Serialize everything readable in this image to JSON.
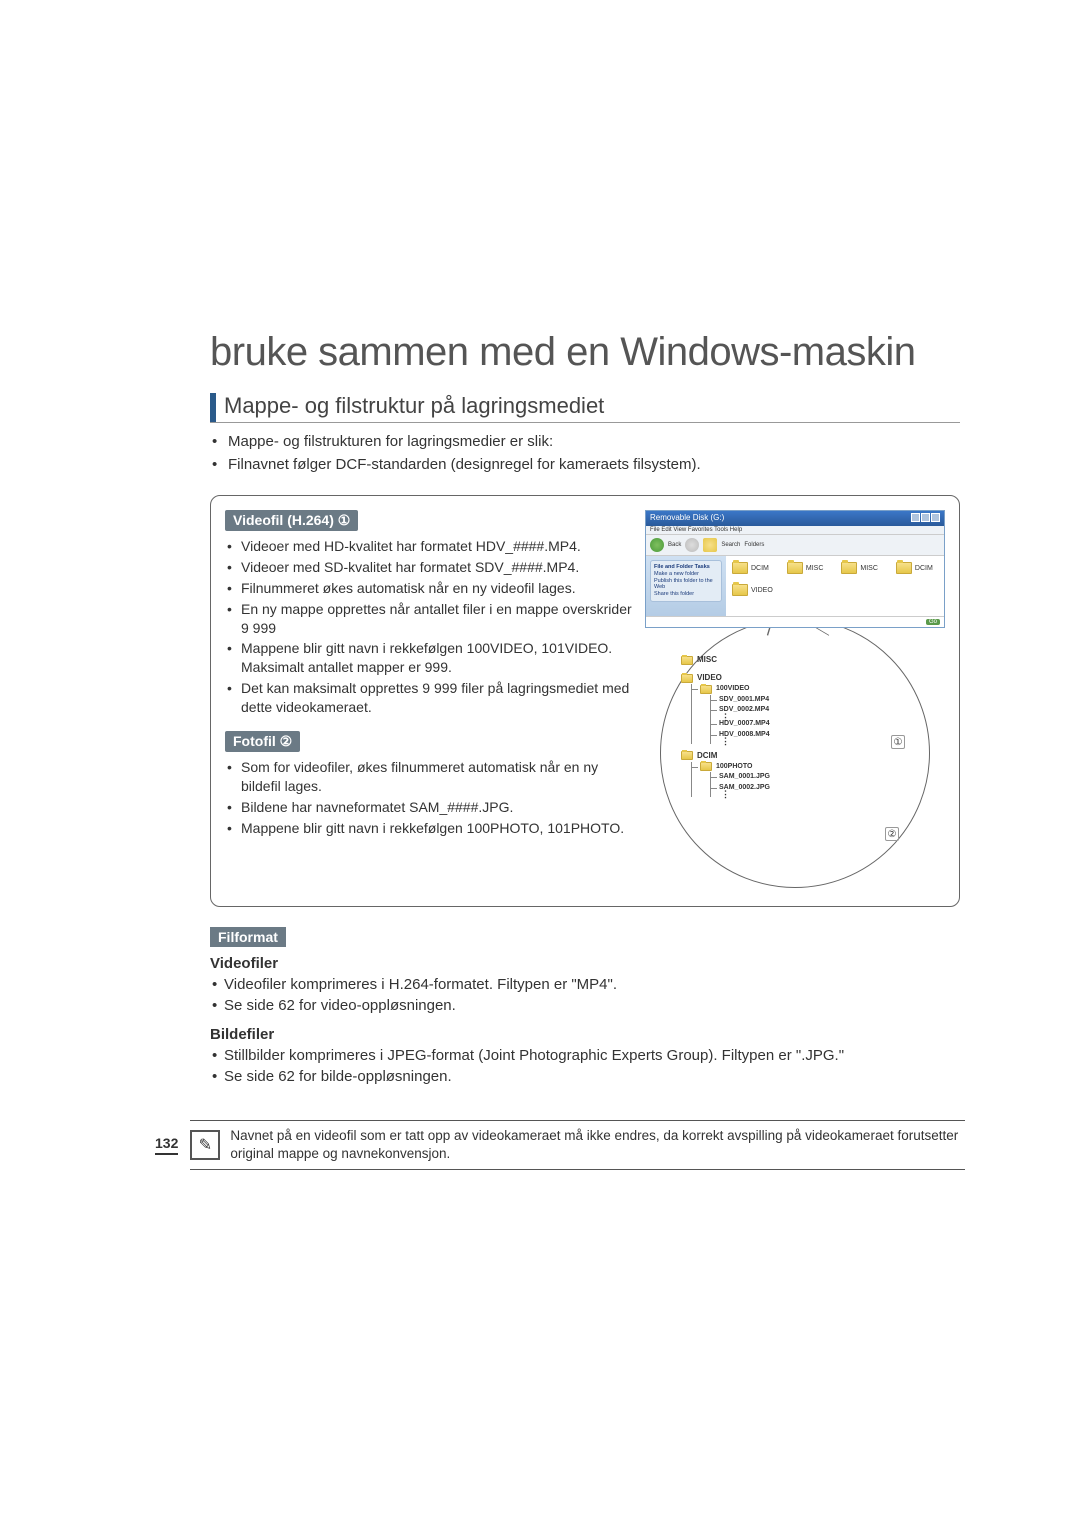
{
  "main_title": "bruke sammen med en Windows-maskin",
  "section_title": "Mappe- og filstruktur på lagringsmediet",
  "intro_bullets": [
    "Mappe- og filstrukturen for lagringsmedier er slik:",
    "Filnavnet følger DCF-standarden (designregel for kameraets filsystem)."
  ],
  "box": {
    "video_tag": "Videofil (H.264) ①",
    "video_bullets": [
      "Videoer med HD-kvalitet har formatet HDV_####.MP4.",
      "Videoer med SD-kvalitet har formatet SDV_####.MP4.",
      "Filnummeret økes automatisk når en ny videofil lages.",
      "En ny mappe opprettes når antallet filer i en mappe overskrider 9 999",
      "Mappene blir gitt navn i rekkefølgen 100VIDEO, 101VIDEO. Maksimalt antallet mapper er 999.",
      "Det kan maksimalt opprettes 9 999 filer på lagringsmediet med dette videokameraet."
    ],
    "photo_tag": "Fotofil ②",
    "photo_bullets": [
      "Som for videofiler, økes filnummeret automatisk når en ny bildefil lages.",
      "Bildene har navneformatet SAM_####.JPG.",
      "Mappene blir gitt navn i rekkefølgen 100PHOTO, 101PHOTO."
    ]
  },
  "explorer": {
    "title": "Removable Disk (G:)",
    "menu": "File  Edit  View  Favorites  Tools  Help",
    "back": "Back",
    "search": "Search",
    "folders_btn": "Folders",
    "go": "Go",
    "side_header": "File and Folder Tasks",
    "side_items": [
      "Make a new folder",
      "Publish this folder to the Web",
      "Share this folder"
    ],
    "folders": [
      "DCIM",
      "MISC",
      "MISC",
      "DCIM",
      "VIDEO"
    ]
  },
  "tree": {
    "misc": "MISC",
    "video": "VIDEO",
    "v100": "100VIDEO",
    "sdv1": "SDV_0001.MP4",
    "sdv2": "SDV_0002.MP4",
    "hdv7": "HDV_0007.MP4",
    "hdv8": "HDV_0008.MP4",
    "dcim": "DCIM",
    "p100": "100PHOTO",
    "sam1": "SAM_0001.JPG",
    "sam2": "SAM_0002.JPG",
    "m1": "①",
    "m2": "②"
  },
  "filformat": {
    "tag": "Filformat",
    "video_head": "Videofiler",
    "video_bullets": [
      "Videofiler komprimeres i H.264-formatet. Filtypen er \"MP4\".",
      "Se side 62 for video-oppløsningen."
    ],
    "image_head": "Bildefiler",
    "image_bullets": [
      "Stillbilder komprimeres i JPEG-format (Joint Photographic Experts Group). Filtypen er \".JPG.\"",
      "Se side 62 for bilde-oppløsningen."
    ]
  },
  "page_number": "132",
  "footnote": "Navnet på en videofil som er tatt opp av videokameraet må ikke endres, da korrekt avspilling på videokameraet forutsetter original mappe og navnekonvensjon.",
  "note_icon_glyph": "✎"
}
